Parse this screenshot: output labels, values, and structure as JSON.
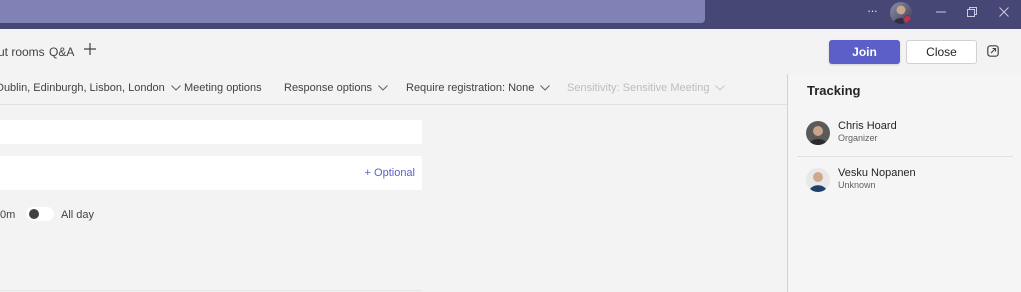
{
  "titlebar": {
    "more_label": "···",
    "window_controls": [
      "minimize",
      "maximize",
      "close"
    ],
    "colors": {
      "background": "#464775",
      "search": "#8082b5"
    }
  },
  "tabs": {
    "items": [
      "ut rooms",
      "Q&A"
    ],
    "add_icon": "plus-icon"
  },
  "actions": {
    "join_label": "Join",
    "close_label": "Close",
    "popout_icon": "popout-icon",
    "accent": "#5b5fc7"
  },
  "options_bar": {
    "timezone": "Dublin, Edinburgh, Lisbon, London",
    "meeting_options": "Meeting options",
    "response_options": "Response options",
    "registration": "Require registration: None",
    "sensitivity": "Sensitivity: Sensitive Meeting"
  },
  "form": {
    "optional_label": "+ Optional",
    "duration_text": "0m",
    "allday_label": "All day",
    "allday_on": false
  },
  "tracking": {
    "title": "Tracking",
    "people": [
      {
        "name": "Chris Hoard",
        "role": "Organizer"
      },
      {
        "name": "Vesku Nopanen",
        "role": "Unknown"
      }
    ]
  }
}
